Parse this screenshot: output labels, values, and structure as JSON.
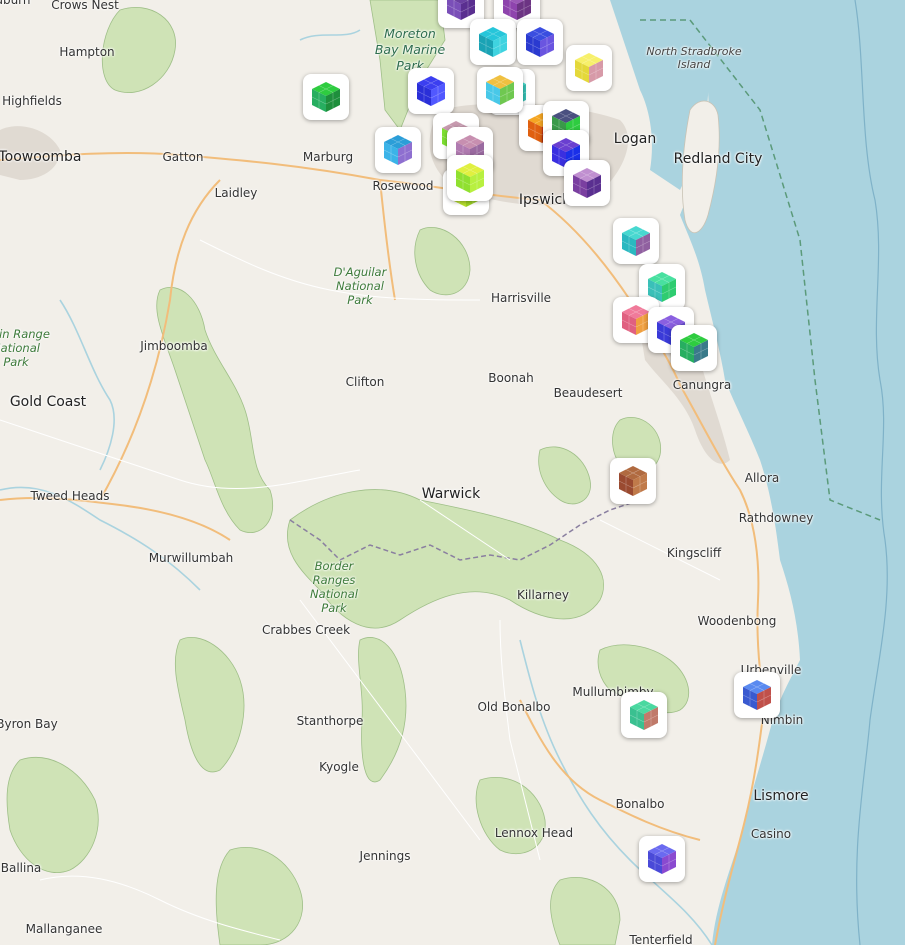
{
  "map": {
    "labels": [
      {
        "text": "Crows Nest",
        "kind": "place"
      },
      {
        "text": "Hampton",
        "kind": "place"
      },
      {
        "text": "Highfields",
        "kind": "place"
      },
      {
        "text": "Toowoomba",
        "kind": "town"
      },
      {
        "text": "Gatton",
        "kind": "place"
      },
      {
        "text": "Laidley",
        "kind": "place"
      },
      {
        "text": "Marburg",
        "kind": "place"
      },
      {
        "text": "Rosewood",
        "kind": "place"
      },
      {
        "text": "Ipswich",
        "kind": "town"
      },
      {
        "text": "Logan",
        "kind": "town"
      },
      {
        "text": "Redland City",
        "kind": "town"
      },
      {
        "text": "North Stradbroke\nIsland",
        "kind": "island"
      },
      {
        "text": "Moreton\nBay Marine\nPark",
        "kind": "marine"
      },
      {
        "text": "D'Aguilar\nNational\nPark",
        "kind": "park"
      },
      {
        "text": "Harrisville",
        "kind": "place"
      },
      {
        "text": "Jimboomba",
        "kind": "place"
      },
      {
        "text": "Main Range\nNational\nPark",
        "kind": "park"
      },
      {
        "text": "Clifton",
        "kind": "place"
      },
      {
        "text": "Boonah",
        "kind": "place"
      },
      {
        "text": "Beaudesert",
        "kind": "place"
      },
      {
        "text": "Canungra",
        "kind": "place"
      },
      {
        "text": "Gold Coast",
        "kind": "town"
      },
      {
        "text": "Allora",
        "kind": "place"
      },
      {
        "text": "Tweed Heads",
        "kind": "place"
      },
      {
        "text": "Warwick",
        "kind": "town"
      },
      {
        "text": "Rathdowney",
        "kind": "place"
      },
      {
        "text": "Kingscliff",
        "kind": "place"
      },
      {
        "text": "Murwillumbah",
        "kind": "place"
      },
      {
        "text": "Killarney",
        "kind": "place"
      },
      {
        "text": "Border\nRanges\nNational\nPark",
        "kind": "park"
      },
      {
        "text": "Woodenbong",
        "kind": "place"
      },
      {
        "text": "Crabbes Creek",
        "kind": "place"
      },
      {
        "text": "Urbenville",
        "kind": "place"
      },
      {
        "text": "Mullumbimby",
        "kind": "place"
      },
      {
        "text": "Nimbin",
        "kind": "place"
      },
      {
        "text": "Byron Bay",
        "kind": "place"
      },
      {
        "text": "Stanthorpe",
        "kind": "place"
      },
      {
        "text": "Old Bonalbo",
        "kind": "place"
      },
      {
        "text": "Kyogle",
        "kind": "place"
      },
      {
        "text": "Bonalbo",
        "kind": "place"
      },
      {
        "text": "Lismore",
        "kind": "town"
      },
      {
        "text": "Lennox Head",
        "kind": "place"
      },
      {
        "text": "Casino",
        "kind": "place"
      },
      {
        "text": "Ballina",
        "kind": "place"
      },
      {
        "text": "Jennings",
        "kind": "place"
      },
      {
        "text": "Mallanganee",
        "kind": "place"
      },
      {
        "text": "Tenterfield",
        "kind": "place"
      },
      {
        "text": "Woodburn",
        "kind": "place"
      }
    ],
    "markers": [
      {
        "name": "marker-01",
        "top": "#6a3fa0",
        "left": "#7a4fb8",
        "right": "#5a2f90"
      },
      {
        "name": "marker-02",
        "top": "#9b59b6",
        "left": "#8e44ad",
        "right": "#6c3483"
      },
      {
        "name": "marker-03",
        "top": "#26c6da",
        "left": "#1aa3b5",
        "right": "#3fd3e0"
      },
      {
        "name": "marker-04",
        "top": "#3a4ee0",
        "left": "#2a3ad0",
        "right": "#6a55e0"
      },
      {
        "name": "marker-05",
        "top": "#f7f06a",
        "left": "#e4d83a",
        "right": "#d79aa8"
      },
      {
        "name": "marker-06",
        "top": "#2ecc40",
        "left": "#27ae60",
        "right": "#1e8f3c"
      },
      {
        "name": "marker-07",
        "top": "#3b3ff0",
        "left": "#2a2fd8",
        "right": "#5158ff"
      },
      {
        "name": "marker-08",
        "top": "#43e0d0",
        "left": "#9b7d5a",
        "right": "#36c0b4"
      },
      {
        "name": "marker-09",
        "top": "#c89bb0",
        "left": "#7ee032",
        "right": "#5cd624"
      },
      {
        "name": "marker-10",
        "top": "#2b9ed8",
        "left": "#3bb3e8",
        "right": "#8e6fd0"
      },
      {
        "name": "marker-11",
        "top": "#d9f04a",
        "left": "#b8e02e",
        "right": "#9bd124"
      },
      {
        "name": "marker-12",
        "top": "#c78fb0",
        "left": "#b07ab0",
        "right": "#9a6aa0"
      },
      {
        "name": "marker-13",
        "top": "#f5a623",
        "left": "#e06010",
        "right": "#d03a10"
      },
      {
        "name": "marker-14",
        "top": "#4a5080",
        "left": "#3a9a4a",
        "right": "#2ecc40"
      },
      {
        "name": "marker-15",
        "top": "#6a3fd0",
        "left": "#3a2fe0",
        "right": "#1a2fe8"
      },
      {
        "name": "marker-16",
        "top": "#c08fd0",
        "left": "#7a3fa0",
        "right": "#5a2f90"
      },
      {
        "name": "marker-17",
        "top": "#e0f040",
        "left": "#90e030",
        "right": "#b8f040"
      },
      {
        "name": "marker-18",
        "top": "#f0c040",
        "left": "#48c8e8",
        "right": "#6fc850"
      },
      {
        "name": "marker-19",
        "top": "#48d8d0",
        "left": "#2ab8c0",
        "right": "#9060a0"
      },
      {
        "name": "marker-20",
        "top": "#48e0a0",
        "left": "#3ac0b8",
        "right": "#2ecc70"
      },
      {
        "name": "marker-21",
        "top": "#f07a9a",
        "left": "#e06080",
        "right": "#f0a040"
      },
      {
        "name": "marker-22",
        "top": "#8a5fe0",
        "left": "#3a3ad8",
        "right": "#6a4fd0"
      },
      {
        "name": "marker-23",
        "top": "#2ecc40",
        "left": "#27ae60",
        "right": "#3a7a8a"
      },
      {
        "name": "marker-24",
        "top": "#b06a40",
        "left": "#9a4a30",
        "right": "#c07a4a"
      },
      {
        "name": "marker-25",
        "top": "#5a8af0",
        "left": "#3a5ad0",
        "right": "#c0504a"
      },
      {
        "name": "marker-26",
        "top": "#4ad8a0",
        "left": "#3ac090",
        "right": "#c07a6a"
      },
      {
        "name": "marker-27",
        "top": "#6a6af0",
        "left": "#4a4ad8",
        "right": "#8a4ad0"
      }
    ]
  }
}
